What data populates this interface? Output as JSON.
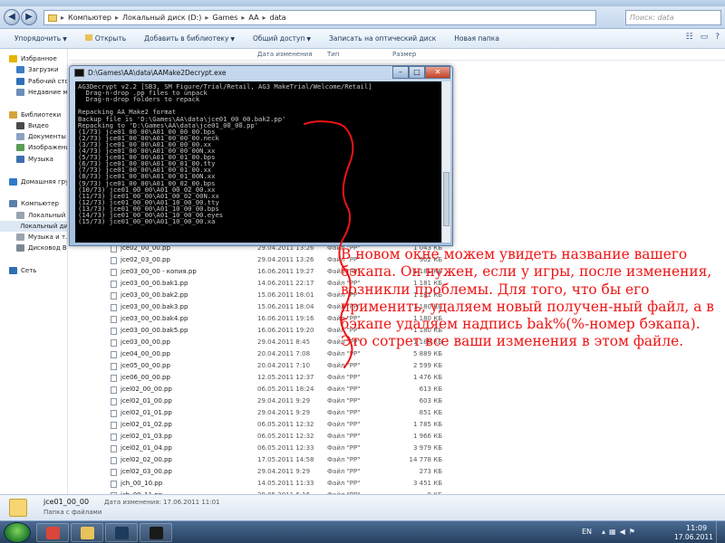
{
  "address": {
    "crumbs": [
      "Компьютер",
      "Локальный диск (D:)",
      "Games",
      "AA",
      "data"
    ],
    "search_placeholder": "Поиск: data"
  },
  "toolbar": {
    "organize": "Упорядочить",
    "open": "Открыть",
    "add_library": "Добавить в библиотеку",
    "share": "Общий доступ",
    "burn": "Записать на оптический диск",
    "new_folder": "Новая папка"
  },
  "sidebar": {
    "items": [
      {
        "label": "Избранное",
        "icon": "star-icon",
        "color": "#e6b400"
      },
      {
        "label": "Загрузки",
        "icon": "downloads-icon",
        "color": "#3c7ec4"
      },
      {
        "label": "Рабочий стол",
        "icon": "desktop-icon",
        "color": "#2f6fb6"
      },
      {
        "label": "Недавние места",
        "icon": "recent-places-icon",
        "color": "#6d8fb7"
      },
      {
        "label": "Библиотеки",
        "icon": "libraries-icon",
        "color": "#d4a43a"
      },
      {
        "label": "Видео",
        "icon": "video-icon",
        "color": "#4a4a4a"
      },
      {
        "label": "Документы",
        "icon": "documents-icon",
        "color": "#8aa2c2"
      },
      {
        "label": "Изображения",
        "icon": "images-icon",
        "color": "#5b9b55"
      },
      {
        "label": "Музыка",
        "icon": "music-icon",
        "color": "#3d6fb0"
      },
      {
        "label": "Домашняя группа",
        "icon": "homegroup-icon",
        "color": "#2d7bc9"
      },
      {
        "label": "Компьютер",
        "icon": "computer-icon",
        "color": "#5a7fa8"
      },
      {
        "label": "Локальный ди",
        "icon": "disk-icon",
        "color": "#9aa4b0"
      },
      {
        "label": "Локальный ди",
        "icon": "disk-icon",
        "color": "#9aa4b0"
      },
      {
        "label": "Музыка и т.п",
        "icon": "disk-icon",
        "color": "#9aa4b0"
      },
      {
        "label": "Дисковод BD-",
        "icon": "bd-drive-icon",
        "color": "#7c8794"
      },
      {
        "label": "Сеть",
        "icon": "network-icon",
        "color": "#2e6eb2"
      }
    ]
  },
  "columns": {
    "date": "Дата изменения",
    "type": "Тип",
    "size": "Размер"
  },
  "files": [
    {
      "name": "jce02_00_00.pp",
      "date": "29.04.2011 13:26",
      "type": "Файл \"PP\"",
      "size": "1 043 КБ"
    },
    {
      "name": "jce02_03_00.pp",
      "date": "29.04.2011 13:26",
      "type": "Файл \"PP\"",
      "size": "902 КБ"
    },
    {
      "name": "jce03_00_00 - копия.pp",
      "date": "16.06.2011 19:27",
      "type": "Файл \"PP\"",
      "size": "1 181 КБ"
    },
    {
      "name": "jce03_00_00.bak1.pp",
      "date": "14.06.2011 22:17",
      "type": "Файл \"PP\"",
      "size": "1 181 КБ"
    },
    {
      "name": "jce03_00_00.bak2.pp",
      "date": "15.06.2011 18:01",
      "type": "Файл \"PP\"",
      "size": "1 181 КБ"
    },
    {
      "name": "jce03_00_00.bak3.pp",
      "date": "15.06.2011 18:04",
      "type": "Файл \"PP\"",
      "size": "1 180 КБ"
    },
    {
      "name": "jce03_00_00.bak4.pp",
      "date": "16.06.2011 19:16",
      "type": "Файл \"PP\"",
      "size": "1 180 КБ"
    },
    {
      "name": "jce03_00_00.bak5.pp",
      "date": "16.06.2011 19:20",
      "type": "Файл \"PP\"",
      "size": "1 180 КБ"
    },
    {
      "name": "jce03_00_00.pp",
      "date": "29.04.2011 8:45",
      "type": "Файл \"PP\"",
      "size": "1 185 КБ"
    },
    {
      "name": "jce04_00_00.pp",
      "date": "20.04.2011 7:08",
      "type": "Файл \"PP\"",
      "size": "5 889 КБ"
    },
    {
      "name": "jce05_00_00.pp",
      "date": "20.04.2011 7:10",
      "type": "Файл \"PP\"",
      "size": "2 599 КБ"
    },
    {
      "name": "jce06_00_00.pp",
      "date": "12.05.2011 12:37",
      "type": "Файл \"PP\"",
      "size": "1 476 КБ"
    },
    {
      "name": "jcel02_00_00.pp",
      "date": "06.05.2011 18:24",
      "type": "Файл \"PP\"",
      "size": "613 КБ"
    },
    {
      "name": "jcel02_01_00.pp",
      "date": "29.04.2011 9:29",
      "type": "Файл \"PP\"",
      "size": "603 КБ"
    },
    {
      "name": "jcel02_01_01.pp",
      "date": "29.04.2011 9:29",
      "type": "Файл \"PP\"",
      "size": "851 КБ"
    },
    {
      "name": "jcel02_01_02.pp",
      "date": "06.05.2011 12:32",
      "type": "Файл \"PP\"",
      "size": "1 785 КБ"
    },
    {
      "name": "jcel02_01_03.pp",
      "date": "06.05.2011 12:32",
      "type": "Файл \"PP\"",
      "size": "1 966 КБ"
    },
    {
      "name": "jcel02_01_04.pp",
      "date": "06.05.2011 12:33",
      "type": "Файл \"PP\"",
      "size": "3 979 КБ"
    },
    {
      "name": "jcel02_02_00.pp",
      "date": "17.05.2011 14:58",
      "type": "Файл \"PP\"",
      "size": "14 778 КБ"
    },
    {
      "name": "jcel02_03_00.pp",
      "date": "29.04.2011 9:29",
      "type": "Файл \"PP\"",
      "size": "273 КБ"
    },
    {
      "name": "jch_00_10.pp",
      "date": "14.05.2011 11:33",
      "type": "Файл \"PP\"",
      "size": "3 451 КБ"
    },
    {
      "name": "jch_00_11.pp",
      "date": "29.05.2011 6:16",
      "type": "Файл \"PP\"",
      "size": "8 КБ"
    }
  ],
  "console": {
    "title": "D:\\Games\\AA\\data\\AAMake2Decrypt.exe",
    "lines": [
      "AG3Decrypt v2.2 [SB3, SM Figure/Trial/Retail, AG3 MakeTrial/Welcome/Retail]",
      "  Drag-n-drop .pp files to unpack",
      "  Drag-n-drop folders to repack",
      "",
      "Repacking AA_Make2 format",
      "Backup file is 'D:\\Games\\AA\\data\\jce01_00_00.bak2.pp'",
      "Repacking to 'D:\\Games\\AA\\data\\jce01_00_00.pp'",
      "(1/73) jce01_00_00\\A01_00_00_00.bps",
      "(2/73) jce01_00_00\\A01_00_00_00.neck",
      "(3/73) jce01_00_00\\A01_00_00_00.xx",
      "(4/73) jce01_00_00\\A01_00_00_00N.xx",
      "(5/73) jce01_00_00\\A01_00_01_00.bps",
      "(6/73) jce01_00_00\\A01_00_01_00.tty",
      "(7/73) jce01_00_00\\A01_00_01_00.xx",
      "(8/73) jce01_00_00\\A01_00_01_00N.xx",
      "(9/73) jce01_00_00\\A01_00_02_00.bps",
      "(10/73) jce01_00_00\\A01_00_02_00.xx",
      "(11/73) jce01_00_00\\A01_00_02_00N.xx",
      "(12/73) jce01_00_00\\A01_10_00_00.tty",
      "(13/73) jce01_00_00\\A01_10_00_00.bps",
      "(14/73) jce01_00_00\\A01_10_00_00.eyes",
      "(15/73) jce01_00_00\\A01_10_00_00.xa"
    ]
  },
  "annotation": {
    "text": "В новом окне можем увидеть название вашего бэкапа. Он нужен, если у игры, после изменения, возникли проблемы. Для того, что бы его применить, удаляем новый получен-ный файл, а в бэкапе удаляем надпись bak%(%-номер бэкапа). Это сотрет все ваши изменения в этом файле."
  },
  "details": {
    "name": "jce01_00_00",
    "modified": "Дата изменения: 17.06.2011 11:01",
    "type": "Папка с файлами"
  },
  "taskbar": {
    "lang": "EN",
    "time": "11:09",
    "date": "17.06.2011",
    "apps": [
      {
        "icon": "chrome-icon",
        "color": "#d9463b"
      },
      {
        "icon": "explorer-icon",
        "color": "#e8c25a"
      },
      {
        "icon": "photoshop-icon",
        "color": "#1c3b5e"
      },
      {
        "icon": "console-icon",
        "color": "#1a1a1a"
      }
    ]
  },
  "colors": {
    "annotation": "#ee1414",
    "console_bg": "#000000",
    "console_text": "#c7c7c7"
  }
}
